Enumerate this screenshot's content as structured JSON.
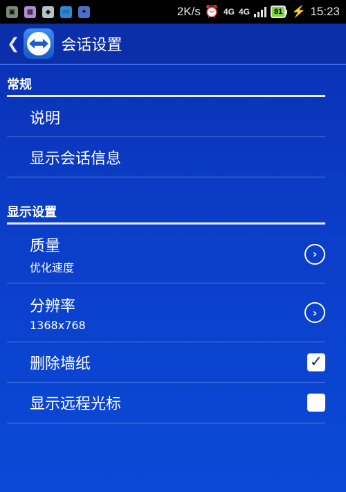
{
  "status_bar": {
    "speed": "2K/s",
    "net_type_primary": "4G",
    "net_type_secondary": "4G",
    "battery": "81",
    "time": "15:23",
    "notification_icons": [
      "gallery-icon",
      "photo-icon",
      "shield-app-icon",
      "screen-share-icon",
      "game-icon"
    ]
  },
  "action_bar": {
    "title": "会话设置",
    "back_glyph": "❮"
  },
  "sections": {
    "general": {
      "header": "常规",
      "items": [
        {
          "label": "说明"
        },
        {
          "label": "显示会话信息"
        }
      ]
    },
    "display": {
      "header": "显示设置",
      "items": [
        {
          "label": "质量",
          "sublabel": "优化速度",
          "widget": "chevron"
        },
        {
          "label": "分辨率",
          "sublabel": "1368x768",
          "widget": "chevron"
        },
        {
          "label": "删除墙纸",
          "widget": "checkbox",
          "checked": true
        },
        {
          "label": "显示远程光标",
          "widget": "checkbox",
          "checked": false
        }
      ]
    }
  },
  "colors": {
    "background": "#0a3cc4",
    "divider": "#e8eefc"
  }
}
